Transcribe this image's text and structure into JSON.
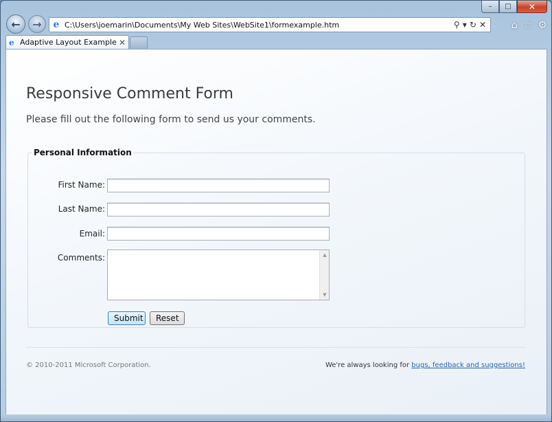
{
  "browser": {
    "address": "C:\\Users\\joemarin\\Documents\\My Web Sites\\WebSite1\\formexample.htm",
    "tab_title": "Adaptive Layout Example",
    "caption": {
      "minimize": "–",
      "maximize": "□",
      "close": "✕"
    },
    "icons": [
      "back-arrow-icon",
      "forward-arrow-icon",
      "ie-logo-icon",
      "search-icon",
      "refresh-icon",
      "stop-icon",
      "home-icon",
      "favorites-star-icon",
      "gear-icon"
    ]
  },
  "page": {
    "title": "Responsive Comment Form",
    "subtitle": "Please fill out the following form to send us your comments.",
    "fieldset_legend": "Personal Information",
    "fields": [
      {
        "label": "First Name:",
        "value": ""
      },
      {
        "label": "Last Name:",
        "value": ""
      },
      {
        "label": "Email:",
        "value": ""
      },
      {
        "label": "Comments:",
        "value": ""
      }
    ],
    "submit_label": "Submit",
    "reset_label": "Reset"
  },
  "footer": {
    "copyright": "© 2010-2011 Microsoft Corporation.",
    "feedback_prefix": "We're always looking for ",
    "feedback_link": "bugs, feedback and suggestions!"
  }
}
